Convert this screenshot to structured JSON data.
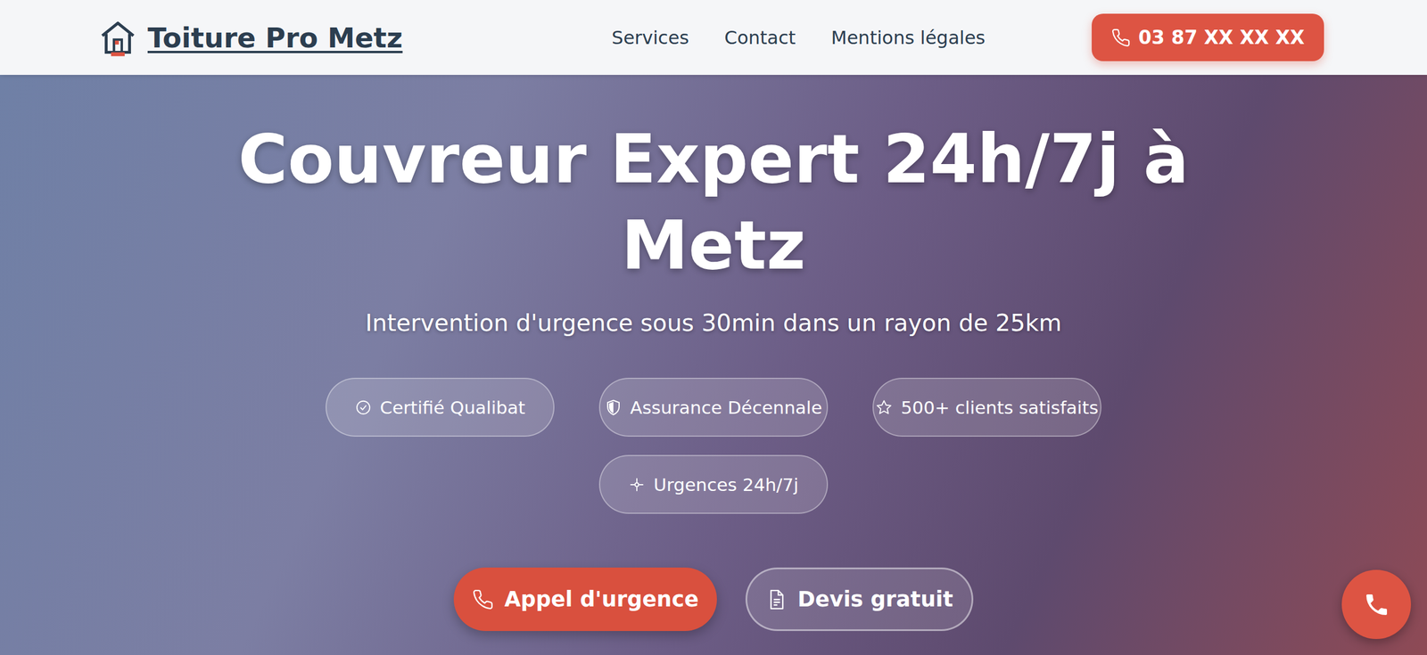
{
  "header": {
    "logo": "Toiture Pro Metz",
    "nav": [
      "Services",
      "Contact",
      "Mentions légales"
    ],
    "phone_button": "03 87 XX XX XX"
  },
  "hero": {
    "title": "Couvreur Expert 24h/7j à Metz",
    "subtitle": "Intervention d'urgence sous 30min dans un rayon de 25km",
    "badges": [
      {
        "label": "Certifié Qualibat",
        "kind": "check"
      },
      {
        "label": "Assurance Décennale",
        "kind": "shield"
      },
      {
        "label": "500+ clients satisfaits",
        "kind": "star"
      },
      {
        "label": "Urgences 24h/7j",
        "kind": "spark"
      }
    ],
    "buttons": [
      {
        "label": "Appel d'urgence",
        "kind": "primary"
      },
      {
        "label": "Devis gratuit",
        "kind": "secondary"
      }
    ]
  }
}
